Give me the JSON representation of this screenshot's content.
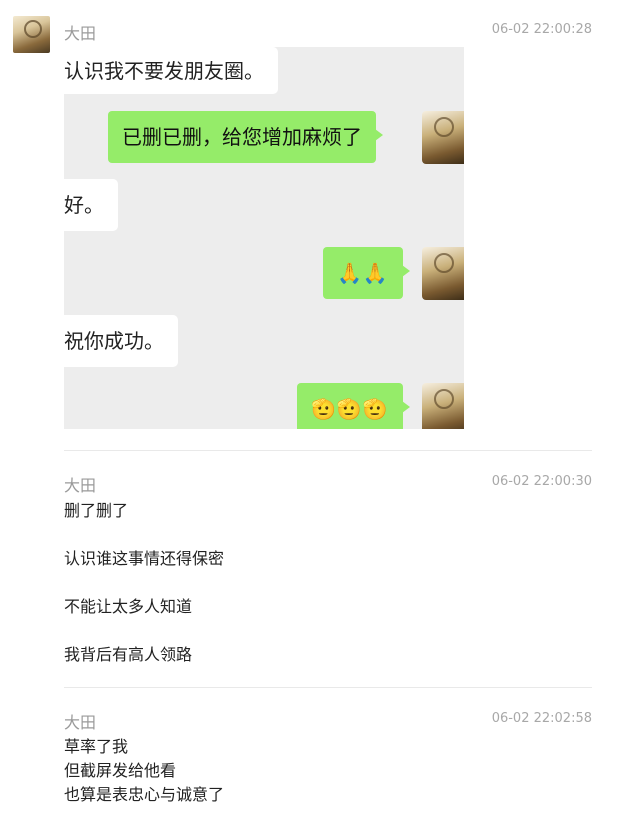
{
  "messages": [
    {
      "sender": "大田",
      "time": "06-02 22:00:28",
      "screenshot": {
        "bubbles": [
          {
            "side": "left",
            "text": "认识我不要发朋友圈。"
          },
          {
            "side": "right",
            "text": "已删已删，给您增加麻烦了"
          },
          {
            "side": "left",
            "text": "好。"
          },
          {
            "side": "right",
            "text": "🙏🙏"
          },
          {
            "side": "left",
            "text": "祝你成功。"
          },
          {
            "side": "right",
            "text": "🫡🫡🫡"
          }
        ]
      }
    },
    {
      "sender": "大田",
      "time": "06-02 22:00:30",
      "lines": [
        "删了删了",
        "认识谁这事情还得保密",
        "不能让太多人知道",
        "我背后有高人领路"
      ]
    },
    {
      "sender": "大田",
      "time": "06-02 22:02:58",
      "lines": [
        "草率了我",
        "但截屏发给他看",
        "也算是表忠心与诚意了"
      ]
    }
  ],
  "colors": {
    "chat_bg": "#ededed",
    "my_bubble": "#95ec69",
    "their_bubble": "#ffffff",
    "meta_text": "#9a9a9a"
  }
}
